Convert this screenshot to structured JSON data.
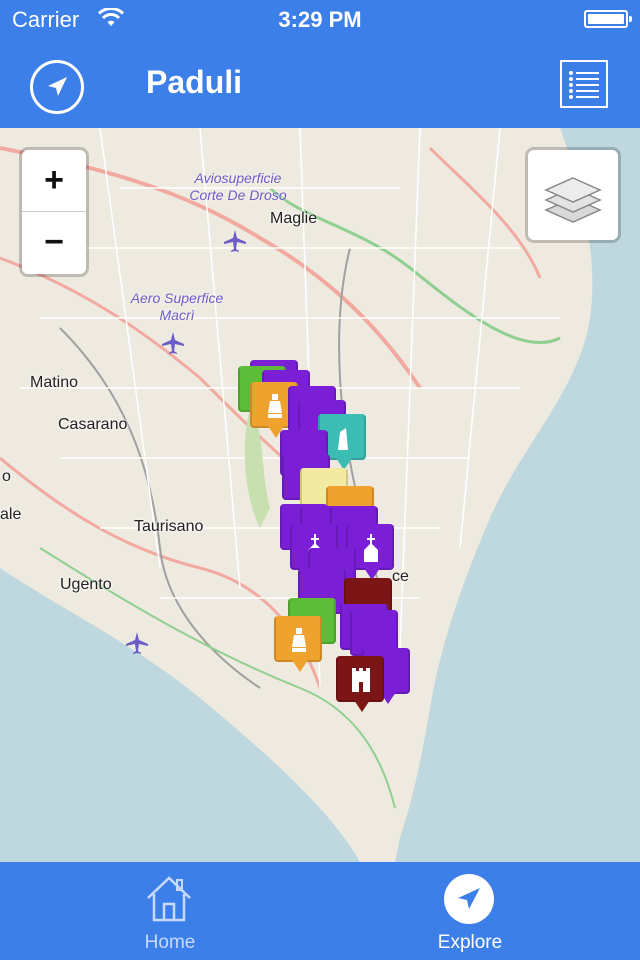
{
  "status": {
    "carrier": "Carrier",
    "time": "3:29 PM"
  },
  "nav": {
    "title": "Paduli",
    "locate_icon": "location-arrow-icon",
    "menu_icon": "list-menu-icon"
  },
  "map": {
    "zoom_in": "+",
    "zoom_out": "−",
    "layers_icon": "layers-icon",
    "towns": {
      "maglie": "Maglie",
      "matino": "Matino",
      "casarano": "Casarano",
      "taurisano": "Taurisano",
      "ugento": "Ugento",
      "partial_o": "o",
      "partial_ale": "ale",
      "partial_ce": "ce"
    },
    "airfields": {
      "corte": "Aviosuperficie Corte De Droso",
      "macri": "Aero Superfice Macrì"
    }
  },
  "tabs": [
    {
      "label": "Home",
      "icon": "home-icon",
      "selected": false
    },
    {
      "label": "Explore",
      "icon": "explore-arrow-icon",
      "selected": true
    }
  ],
  "colors": {
    "accent": "#3d7fe8",
    "poi_church": "#7a1fd6",
    "poi_nature": "#5cbd3a",
    "poi_monument": "#f0a22e",
    "poi_castle": "#7c1515",
    "poi_teal": "#3dbcb4"
  }
}
